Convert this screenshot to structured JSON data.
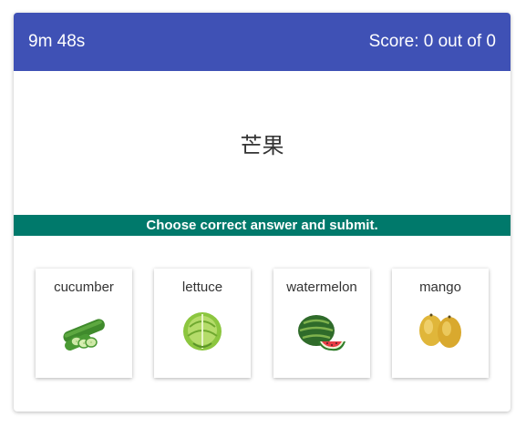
{
  "header": {
    "timer": "9m 48s",
    "score": "Score: 0 out of 0"
  },
  "prompt": {
    "word": "芒果"
  },
  "instruction": "Choose correct answer and submit.",
  "options": [
    {
      "label": "cucumber",
      "icon": "cucumber-icon"
    },
    {
      "label": "lettuce",
      "icon": "lettuce-icon"
    },
    {
      "label": "watermelon",
      "icon": "watermelon-icon"
    },
    {
      "label": "mango",
      "icon": "mango-icon"
    }
  ],
  "colors": {
    "header_bg": "#3f51b5",
    "instruction_bg": "#00796b"
  }
}
